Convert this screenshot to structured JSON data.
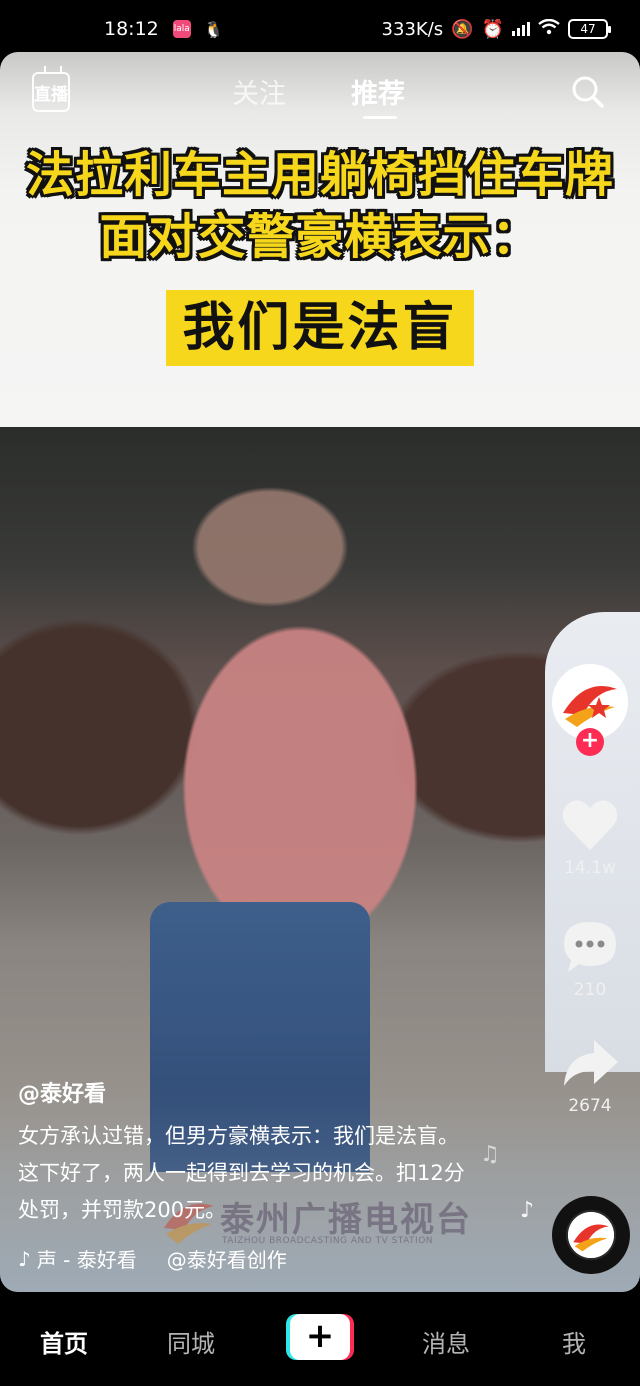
{
  "status_bar": {
    "time": "18:12",
    "app_icon_1": "lala-icon",
    "app_icon_2": "qq-penguin-icon",
    "speed": "333K/s",
    "battery": "47"
  },
  "top_nav": {
    "live_label": "直播",
    "tabs": [
      {
        "label": "关注",
        "active": false
      },
      {
        "label": "推荐",
        "active": true
      }
    ]
  },
  "video": {
    "headline_line1": "法拉利车主用躺椅挡住车牌",
    "headline_line2": "面对交警豪横表示：",
    "headline_box": "我们是法盲"
  },
  "right_rail": {
    "like_count": "14.1w",
    "comment_count": "210",
    "share_count": "2674"
  },
  "caption": {
    "author": "@泰好看",
    "description": "女方承认过错，但男方豪横表示：我们是法盲。这下好了，两人一起得到去学习的机会。扣12分处罚，并罚款200元。",
    "music_label": "声 - 泰好看",
    "music_creator": "@泰好看创作"
  },
  "watermark": {
    "text": "泰州广播电视台",
    "sub": "TAIZHOU BROADCASTING AND TV STATION"
  },
  "bottom_nav": {
    "home": "首页",
    "city": "同城",
    "add": "+",
    "messages": "消息",
    "me": "我"
  },
  "colors": {
    "headline_yellow": "#f6d71b",
    "accent_red": "#fe2c55",
    "accent_cyan": "#2fe6e8"
  }
}
